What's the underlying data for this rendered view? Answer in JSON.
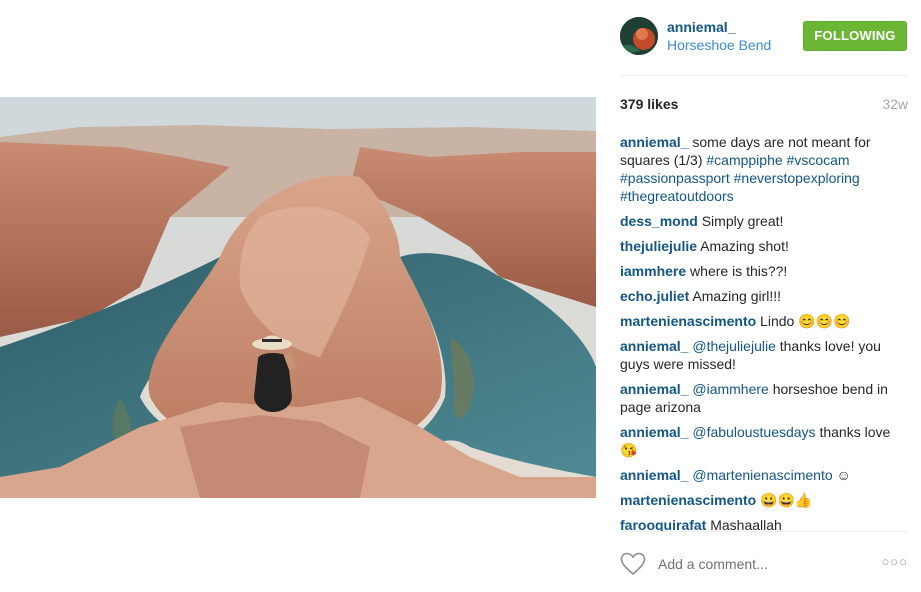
{
  "post": {
    "username": "anniemal_",
    "location": "Horseshoe Bend",
    "follow_label": "FOLLOWING",
    "likes": "379 likes",
    "age": "32w"
  },
  "comments": [
    {
      "author": "anniemal_",
      "parts": [
        {
          "t": " some days are not meant for squares (1/3) "
        },
        {
          "t": "#camppiphe",
          "tag": true
        },
        {
          "t": " "
        },
        {
          "t": "#vscocam",
          "tag": true
        },
        {
          "t": " "
        },
        {
          "t": "#passionpassport",
          "tag": true
        },
        {
          "t": " "
        },
        {
          "t": "#neverstopexploring",
          "tag": true
        },
        {
          "t": " "
        },
        {
          "t": "#thegreatoutdoors",
          "tag": true
        }
      ]
    },
    {
      "author": "dess_mond",
      "parts": [
        {
          "t": " Simply great!"
        }
      ]
    },
    {
      "author": "thejuliejulie",
      "parts": [
        {
          "t": " Amazing shot!"
        }
      ]
    },
    {
      "author": "iammhere",
      "parts": [
        {
          "t": " where is this??!"
        }
      ]
    },
    {
      "author": "echo.juliet",
      "parts": [
        {
          "t": " Amazing girl!!!"
        }
      ]
    },
    {
      "author": "martenienascimento",
      "parts": [
        {
          "t": " Lindo "
        },
        {
          "t": "😊😊😊",
          "emoji": true
        }
      ]
    },
    {
      "author": "anniemal_",
      "parts": [
        {
          "t": " "
        },
        {
          "t": "@thejuliejulie",
          "tag": true
        },
        {
          "t": " thanks love! you guys were missed!"
        }
      ]
    },
    {
      "author": "anniemal_",
      "parts": [
        {
          "t": " "
        },
        {
          "t": "@iammhere",
          "tag": true
        },
        {
          "t": " horseshoe bend in page arizona"
        }
      ]
    },
    {
      "author": "anniemal_",
      "parts": [
        {
          "t": " "
        },
        {
          "t": "@fabuloustuesdays",
          "tag": true
        },
        {
          "t": " thanks love "
        },
        {
          "t": "😘",
          "emoji": true
        }
      ]
    },
    {
      "author": "anniemal_",
      "parts": [
        {
          "t": " "
        },
        {
          "t": "@martenienascimento",
          "tag": true
        },
        {
          "t": " ☺"
        }
      ]
    },
    {
      "author": "martenienascimento",
      "parts": [
        {
          "t": " "
        },
        {
          "t": "😀😀👍",
          "emoji": true
        }
      ]
    },
    {
      "author": "farooquirafat",
      "parts": [
        {
          "t": " Mashaallah"
        }
      ]
    }
  ],
  "footer": {
    "comment_placeholder": "Add a comment...",
    "more_label": "○○○"
  },
  "icons": {
    "like": "heart-outline-icon",
    "more": "more-options-icon"
  },
  "colors": {
    "link": "#125688",
    "location": "#3d8bd0",
    "follow_button": "#6bb735"
  }
}
